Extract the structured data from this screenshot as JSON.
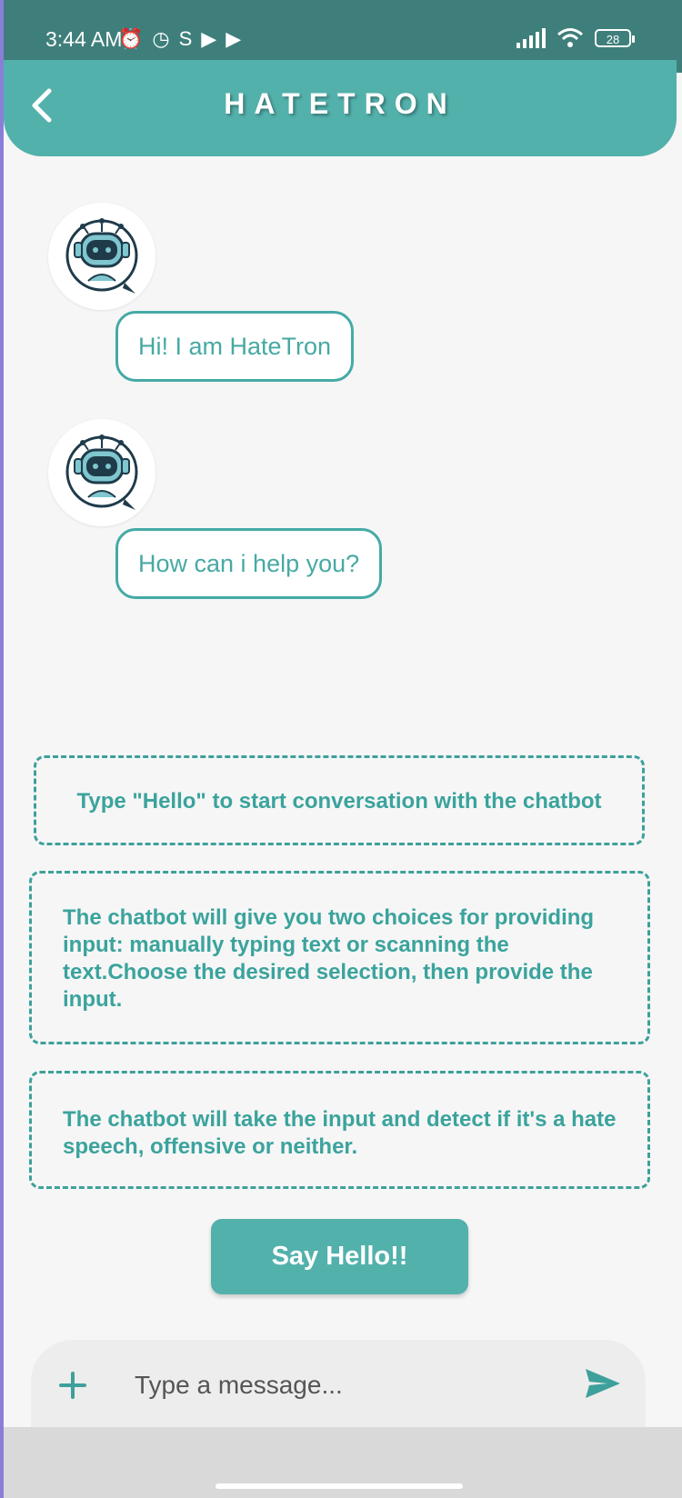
{
  "status_bar": {
    "time": "3:44 AM",
    "battery": "28"
  },
  "app_bar": {
    "title": "HATETRON",
    "back_icon": "chevron-left-icon"
  },
  "chat": {
    "messages": [
      {
        "text": "Hi! I am HateTron"
      },
      {
        "text": "How can i help you?"
      }
    ],
    "avatar_icon": "robot-avatar-icon"
  },
  "instructions": [
    "Type \"Hello\" to start conversation with the chatbot",
    "The chatbot will give you two choices for providing input: manually typing text or scanning the text.Choose the desired selection, then provide the input.",
    "The chatbot will take the input and detect if it's a hate speech, offensive or neither."
  ],
  "say_hello_button": "Say Hello!!",
  "composer": {
    "placeholder": "Type a message...",
    "add_icon": "plus-icon",
    "send_icon": "send-icon"
  },
  "colors": {
    "primary": "#53b1ac",
    "status_bar": "#3f7f7b",
    "accent_text": "#3ba39d",
    "background": "#f6f6f6"
  }
}
